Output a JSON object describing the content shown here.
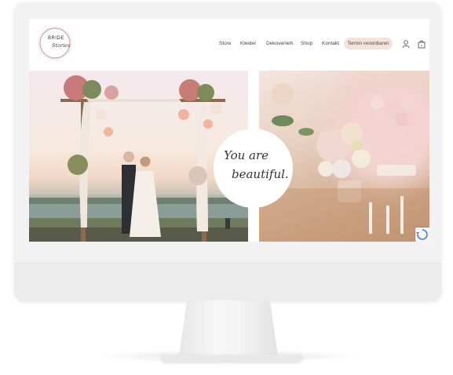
{
  "logo": {
    "line1": "BRIDE",
    "line2": "Stories"
  },
  "nav": {
    "items": [
      {
        "label": "Store"
      },
      {
        "label": "Kleider"
      },
      {
        "label": "Dekoverleih"
      },
      {
        "label": "Shop"
      },
      {
        "label": "Kontakt"
      }
    ],
    "cta_label": "Termin vereinbaren"
  },
  "hero": {
    "script_line1": "You are",
    "script_line2": "beautiful."
  },
  "icons": {
    "account": "user-icon",
    "cart": "shopping-bag-icon",
    "captcha": "recaptcha-badge-icon"
  },
  "colors": {
    "cta_background": "#f3e3de",
    "logo_ring": "#c9a7a1"
  }
}
